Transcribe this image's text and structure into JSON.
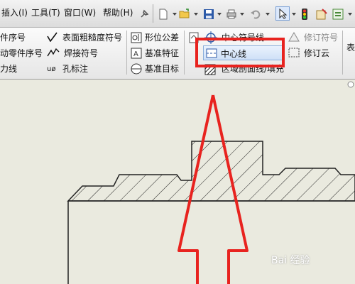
{
  "menubar": {
    "items": [
      "插入(I)",
      "工具(T)",
      "窗口(W)",
      "帮助(H)"
    ]
  },
  "ribbon": {
    "col1": [
      "件序号",
      "动零件序号",
      "力线"
    ],
    "col2": [
      "表面粗糙度符号",
      "焊接符号",
      "孔标注"
    ],
    "col3": [
      "形位公差",
      "基准特征",
      "基准目标"
    ],
    "col4": [
      "中心符号线",
      "中心线",
      "区域剖面线/填充"
    ],
    "col5": [
      "修订符号",
      "修订云"
    ],
    "col6_partial": "表"
  },
  "watermark": {
    "text": "Bai 经验"
  },
  "colors": {
    "highlight_red": "#e8231f",
    "drawing_bg": "#eaeadf",
    "icon_blue": "#2d5aa8"
  }
}
